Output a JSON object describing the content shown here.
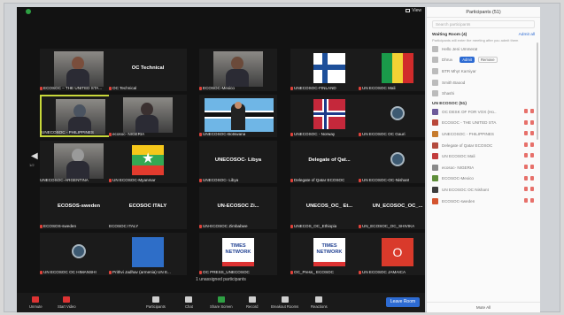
{
  "view_label": "View",
  "unsigned_participants": "1 unassigned participants",
  "grid": [
    {
      "name": "ECOSOC – THE UNITED STA...",
      "kind": "photo",
      "photo": "p1",
      "muted": true
    },
    {
      "name": "OC Technical",
      "kind": "label",
      "big": "OC Technical",
      "muted": true
    },
    {
      "name": "ECOSOC-Mexico",
      "kind": "photo",
      "photo": "p2",
      "muted": true
    },
    {
      "name": "UNECOSOC-FINLAND",
      "kind": "flag",
      "flag": "finland",
      "muted": true
    },
    {
      "name": "UN ECOSOC Mali",
      "kind": "flag",
      "flag": "mali",
      "muted": true
    },
    {
      "name": "UNECOSOC - PHILIPPINES",
      "kind": "photo",
      "photo": "p3",
      "muted": false,
      "active": true
    },
    {
      "name": "ecosoc- NIGERIA",
      "kind": "photo",
      "photo": "p4",
      "muted": true
    },
    {
      "name": "UNECOSOC-Botswana",
      "kind": "photo",
      "photo": "botswana",
      "muted": true
    },
    {
      "name": "UNECOSOC - Norway",
      "kind": "flag",
      "flag": "norway",
      "muted": true
    },
    {
      "name": "UN ECOSOC OC Gauri",
      "kind": "avatar",
      "muted": true
    },
    {
      "name": "UNECOSOC-ARGENTINA",
      "kind": "photo",
      "photo": "p5",
      "muted": false
    },
    {
      "name": "UN ECOSOC-Myanmar",
      "kind": "flag",
      "flag": "myanmar",
      "muted": true
    },
    {
      "name": "UNECOSOC- Libya",
      "kind": "label",
      "big": "UNECOSOC- Libya",
      "muted": true
    },
    {
      "name": "Delegate of Qatar ECOSOC",
      "kind": "label",
      "big": "Delegate of Qat...",
      "muted": true
    },
    {
      "name": "UN ECOSOC-OC-Nishant",
      "kind": "avatar",
      "muted": true
    },
    {
      "name": "ECOSOS-sweden",
      "kind": "label",
      "big": "ECOSOS-sweden",
      "muted": true
    },
    {
      "name": "ECOSOC ITALY",
      "kind": "label",
      "big": "ECOSOC ITALY",
      "muted": false
    },
    {
      "name": "UN-ECOSOC Zimbabwe",
      "kind": "label",
      "big": "UN-ECOSOC Zi...",
      "muted": true
    },
    {
      "name": "UNECOS_OC_Ethiopia",
      "kind": "label",
      "big": "UNECOS_OC_ Et...",
      "muted": true
    },
    {
      "name": "UN_ECOSOC_OC_SHIVIKA",
      "kind": "label",
      "big": "UN_ECOSOC_OC_...",
      "muted": true
    },
    {
      "name": "UN ECOSOC OC HIMANSHI",
      "kind": "avatar",
      "muted": true
    },
    {
      "name": "Prithvi Jadhav (armenia) UN E...",
      "kind": "flag",
      "flag": "blue",
      "muted": true
    },
    {
      "name": "OC PRESS_UNECOSOC",
      "kind": "logo",
      "logo": "TIMES NETWORK",
      "muted": true
    },
    {
      "name": "OC_Press_ ECOSOC",
      "kind": "logo",
      "logo": "TIMES NETWORK",
      "muted": true
    },
    {
      "name": "UN ECOSOC JAMAICA",
      "kind": "letter",
      "letter": "O",
      "muted": true
    }
  ],
  "pager": {
    "left": "1/2",
    "right": "1/2"
  },
  "toolbar": {
    "unmute": "Unmute",
    "video": "Start Video",
    "participants": "Participants",
    "participants_count": "51",
    "chat": "Chat",
    "share": "Share Screen",
    "record": "Record",
    "breakout": "Breakout Rooms",
    "reactions": "Reactions",
    "leave": "Leave Room"
  },
  "panel": {
    "title": "Participants (51)",
    "search_placeholder": "Search participants",
    "waiting_room": "Waiting Room (4)",
    "admit_all": "Admit all",
    "waiting_sub": "Participants will enter the meeting after you admit them",
    "waiting": [
      {
        "name": "Hello Jeni Ummerat"
      },
      {
        "name": "Dhruv",
        "admit": "Admit",
        "remove": "Remove"
      },
      {
        "name": "BTR Mhyt Karniyar"
      },
      {
        "name": "Smith Baood"
      },
      {
        "name": "Shashi"
      }
    ],
    "in_meeting": "UN ECOSOC (51)",
    "members": [
      {
        "name": "OC DESK OF FOR VOX (Ho...",
        "color": "#6d5a9a"
      },
      {
        "name": "ECOSOC - THE UNITED STA...",
        "color": "#b9473a"
      },
      {
        "name": "UNECOSOC - PHILIPPINES",
        "color": "#c77b2d"
      },
      {
        "name": "Delegate of Qatar ECOSOC",
        "color": "#b34a3d"
      },
      {
        "name": "UN ECOSOC Mali",
        "color": "#c23c3c"
      },
      {
        "name": "ecosoc- NIGERIA",
        "color": "#8a8a8a"
      },
      {
        "name": "ECOSOC-Mexico",
        "color": "#5e8e3a"
      },
      {
        "name": "UN ECOSOC OC Nishant",
        "color": "#3c3c3c"
      },
      {
        "name": "ECOSOC-sweden",
        "color": "#d4542f"
      }
    ],
    "mute_all": "Mute All"
  },
  "colors": {
    "accent": "#2d6bd3",
    "share": "#2ea043",
    "active_border": "#c8d83a",
    "mute": "#e0423a"
  }
}
